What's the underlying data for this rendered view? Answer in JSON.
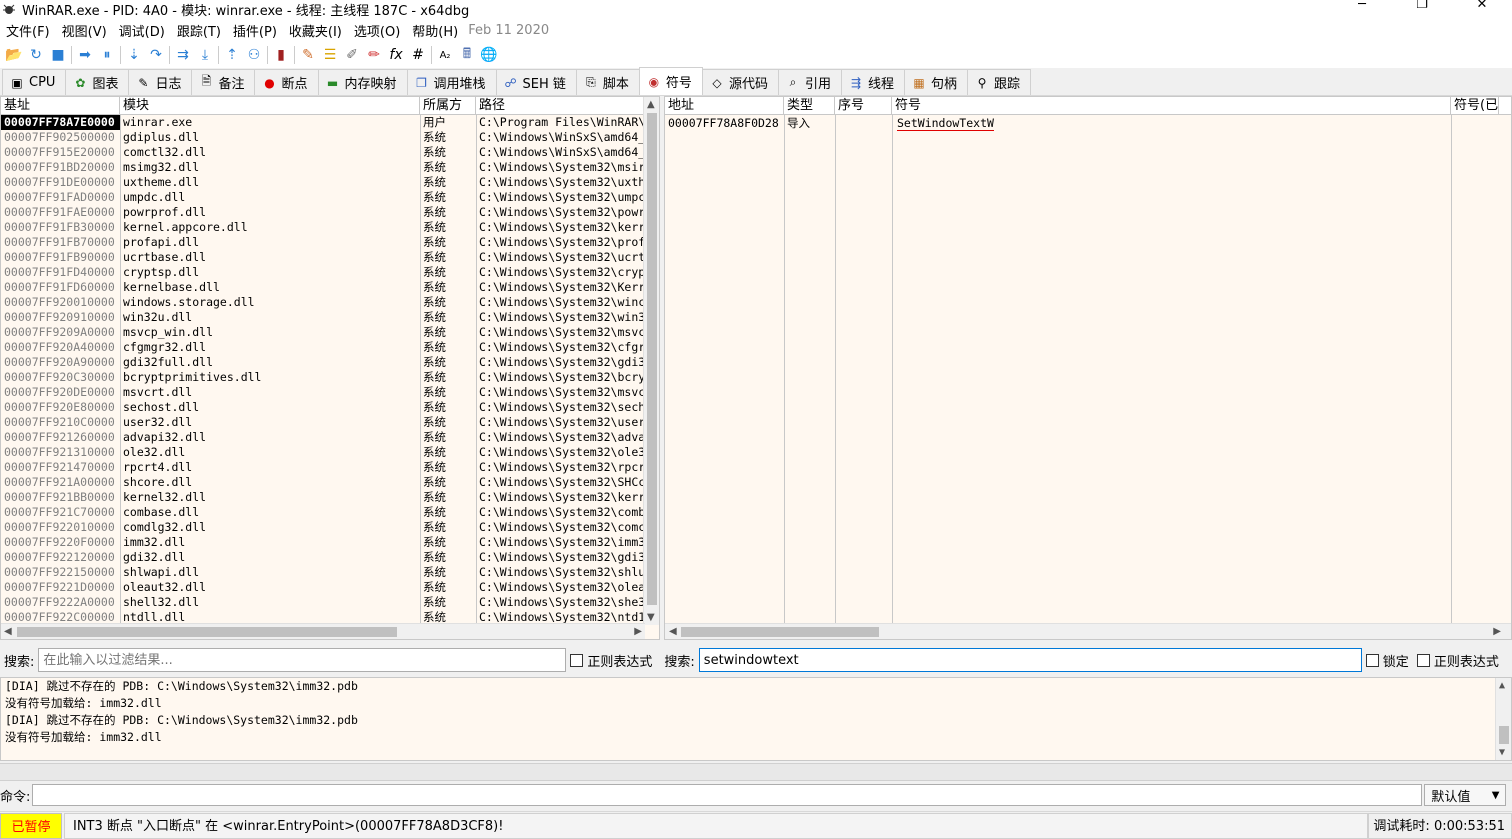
{
  "window": {
    "title": "WinRAR.exe - PID: 4A0 - 模块: winrar.exe - 线程: 主线程 187C - x64dbg"
  },
  "menu": {
    "items": [
      "文件(F)",
      "视图(V)",
      "调试(D)",
      "跟踪(T)",
      "插件(P)",
      "收藏夹(I)",
      "选项(O)",
      "帮助(H)"
    ],
    "date": "Feb 11 2020"
  },
  "toolbar_icons": [
    "open-icon",
    "restart-icon",
    "stop-icon",
    "run-icon",
    "pause-icon",
    "step-into-icon",
    "step-over-icon",
    "trace-into-icon",
    "trace-over-icon",
    "execute-till-return-icon",
    "run-to-user-code-icon",
    "scylla-icon",
    "patch-icon",
    "comments-icon",
    "labels-icon",
    "bookmarks-icon",
    "functions-icon",
    "variables-icon",
    "strings-icon",
    "calculator-icon",
    "globe-icon"
  ],
  "tabs": [
    {
      "label": "CPU",
      "icon": "cpu-icon",
      "glyph": "▣"
    },
    {
      "label": "图表",
      "icon": "graph-icon",
      "glyph": "✿"
    },
    {
      "label": "日志",
      "icon": "log-icon",
      "glyph": "✎"
    },
    {
      "label": "备注",
      "icon": "notes-icon",
      "glyph": "🗎"
    },
    {
      "label": "断点",
      "icon": "breakpoint-icon",
      "glyph": "●"
    },
    {
      "label": "内存映射",
      "icon": "memory-map-icon",
      "glyph": "▬"
    },
    {
      "label": "调用堆栈",
      "icon": "call-stack-icon",
      "glyph": "❐"
    },
    {
      "label": "SEH 链",
      "icon": "seh-icon",
      "glyph": "☍"
    },
    {
      "label": "脚本",
      "icon": "script-icon",
      "glyph": "⎘"
    },
    {
      "label": "符号",
      "icon": "symbols-icon",
      "glyph": "◉"
    },
    {
      "label": "源代码",
      "icon": "source-icon",
      "glyph": "◇"
    },
    {
      "label": "引用",
      "icon": "references-icon",
      "glyph": "⌕"
    },
    {
      "label": "线程",
      "icon": "threads-icon",
      "glyph": "⇶"
    },
    {
      "label": "句柄",
      "icon": "handles-icon",
      "glyph": "▦"
    },
    {
      "label": "跟踪",
      "icon": "trace-icon",
      "glyph": "⚲"
    }
  ],
  "active_tab": "符号",
  "modules": {
    "columns": [
      "基址",
      "模块",
      "所属方",
      "路径"
    ],
    "rows": [
      {
        "base": "00007FF78A7E0000",
        "module": "winrar.exe",
        "party": "用户",
        "path": "C:\\Program Files\\WinRAR\\"
      },
      {
        "base": "00007FF902500000",
        "module": "gdiplus.dll",
        "party": "系统",
        "path": "C:\\Windows\\WinSxS\\amd64_"
      },
      {
        "base": "00007FF915E20000",
        "module": "comctl32.dll",
        "party": "系统",
        "path": "C:\\Windows\\WinSxS\\amd64_"
      },
      {
        "base": "00007FF91BD20000",
        "module": "msimg32.dll",
        "party": "系统",
        "path": "C:\\Windows\\System32\\msir"
      },
      {
        "base": "00007FF91DE00000",
        "module": "uxtheme.dll",
        "party": "系统",
        "path": "C:\\Windows\\System32\\uxth"
      },
      {
        "base": "00007FF91FAD0000",
        "module": "umpdc.dll",
        "party": "系统",
        "path": "C:\\Windows\\System32\\umpc"
      },
      {
        "base": "00007FF91FAE0000",
        "module": "powrprof.dll",
        "party": "系统",
        "path": "C:\\Windows\\System32\\powr"
      },
      {
        "base": "00007FF91FB30000",
        "module": "kernel.appcore.dll",
        "party": "系统",
        "path": "C:\\Windows\\System32\\kerr"
      },
      {
        "base": "00007FF91FB70000",
        "module": "profapi.dll",
        "party": "系统",
        "path": "C:\\Windows\\System32\\prof"
      },
      {
        "base": "00007FF91FB90000",
        "module": "ucrtbase.dll",
        "party": "系统",
        "path": "C:\\Windows\\System32\\ucrt"
      },
      {
        "base": "00007FF91FD40000",
        "module": "cryptsp.dll",
        "party": "系统",
        "path": "C:\\Windows\\System32\\cryp"
      },
      {
        "base": "00007FF91FD60000",
        "module": "kernelbase.dll",
        "party": "系统",
        "path": "C:\\Windows\\System32\\Kerr"
      },
      {
        "base": "00007FF920010000",
        "module": "windows.storage.dll",
        "party": "系统",
        "path": "C:\\Windows\\System32\\winc"
      },
      {
        "base": "00007FF920910000",
        "module": "win32u.dll",
        "party": "系统",
        "path": "C:\\Windows\\System32\\win3"
      },
      {
        "base": "00007FF9209A0000",
        "module": "msvcp_win.dll",
        "party": "系统",
        "path": "C:\\Windows\\System32\\msvc"
      },
      {
        "base": "00007FF920A40000",
        "module": "cfgmgr32.dll",
        "party": "系统",
        "path": "C:\\Windows\\System32\\cfgr"
      },
      {
        "base": "00007FF920A90000",
        "module": "gdi32full.dll",
        "party": "系统",
        "path": "C:\\Windows\\System32\\gdi3"
      },
      {
        "base": "00007FF920C30000",
        "module": "bcryptprimitives.dll",
        "party": "系统",
        "path": "C:\\Windows\\System32\\bcry"
      },
      {
        "base": "00007FF920DE0000",
        "module": "msvcrt.dll",
        "party": "系统",
        "path": "C:\\Windows\\System32\\msvc"
      },
      {
        "base": "00007FF920E80000",
        "module": "sechost.dll",
        "party": "系统",
        "path": "C:\\Windows\\System32\\sech"
      },
      {
        "base": "00007FF9210C0000",
        "module": "user32.dll",
        "party": "系统",
        "path": "C:\\Windows\\System32\\user"
      },
      {
        "base": "00007FF921260000",
        "module": "advapi32.dll",
        "party": "系统",
        "path": "C:\\Windows\\System32\\adva"
      },
      {
        "base": "00007FF921310000",
        "module": "ole32.dll",
        "party": "系统",
        "path": "C:\\Windows\\System32\\ole3"
      },
      {
        "base": "00007FF921470000",
        "module": "rpcrt4.dll",
        "party": "系统",
        "path": "C:\\Windows\\System32\\rpcr"
      },
      {
        "base": "00007FF921A00000",
        "module": "shcore.dll",
        "party": "系统",
        "path": "C:\\Windows\\System32\\SHCc"
      },
      {
        "base": "00007FF921BB0000",
        "module": "kernel32.dll",
        "party": "系统",
        "path": "C:\\Windows\\System32\\kerr"
      },
      {
        "base": "00007FF921C70000",
        "module": "combase.dll",
        "party": "系统",
        "path": "C:\\Windows\\System32\\comb"
      },
      {
        "base": "00007FF922010000",
        "module": "comdlg32.dll",
        "party": "系统",
        "path": "C:\\Windows\\System32\\comc"
      },
      {
        "base": "00007FF9220F0000",
        "module": "imm32.dll",
        "party": "系统",
        "path": "C:\\Windows\\System32\\imm3"
      },
      {
        "base": "00007FF922120000",
        "module": "gdi32.dll",
        "party": "系统",
        "path": "C:\\Windows\\System32\\gdi3"
      },
      {
        "base": "00007FF922150000",
        "module": "shlwapi.dll",
        "party": "系统",
        "path": "C:\\Windows\\System32\\shlu"
      },
      {
        "base": "00007FF9221D0000",
        "module": "oleaut32.dll",
        "party": "系统",
        "path": "C:\\Windows\\System32\\olea"
      },
      {
        "base": "00007FF9222A0000",
        "module": "shell32.dll",
        "party": "系统",
        "path": "C:\\Windows\\System32\\she3"
      },
      {
        "base": "00007FF922C00000",
        "module": "ntdll.dll",
        "party": "系统",
        "path": "C:\\Windows\\System32\\ntd1"
      }
    ]
  },
  "symbols": {
    "columns": [
      "地址",
      "类型",
      "序号",
      "符号",
      "符号(已"
    ],
    "rows": [
      {
        "address": "00007FF78A8F0D28",
        "type": "导入",
        "ordinal": "",
        "symbol": "SetWindowTextW"
      }
    ]
  },
  "search_left": {
    "label": "搜索:",
    "placeholder": "在此输入以过滤结果...",
    "value": "",
    "regex_label": "正则表达式"
  },
  "search_right": {
    "label": "搜索:",
    "value": "setwindowtext",
    "lock_label": "锁定",
    "regex_label": "正则表达式"
  },
  "log": {
    "lines": [
      "[DIA] 跳过不存在的 PDB: C:\\Windows\\System32\\imm32.pdb",
      "没有符号加载给: imm32.dll",
      "[DIA] 跳过不存在的 PDB: C:\\Windows\\System32\\imm32.pdb",
      "没有符号加载给: imm32.dll"
    ]
  },
  "command": {
    "label": "命令:",
    "value": "",
    "mode": "默认值"
  },
  "status": {
    "state": "已暂停",
    "message": "INT3 断点 \"入口断点\" 在 <winrar.EntryPoint>(00007FF78A8D3CF8)!",
    "timer_label": "调试耗时:",
    "timer_value": "0:00:53:51"
  },
  "colors": {
    "selected_bg": "#000000",
    "panel_bg": "#fff8f0",
    "paused_bg": "#ffff00",
    "paused_fg": "#ff0000",
    "underline": "#e00000"
  }
}
